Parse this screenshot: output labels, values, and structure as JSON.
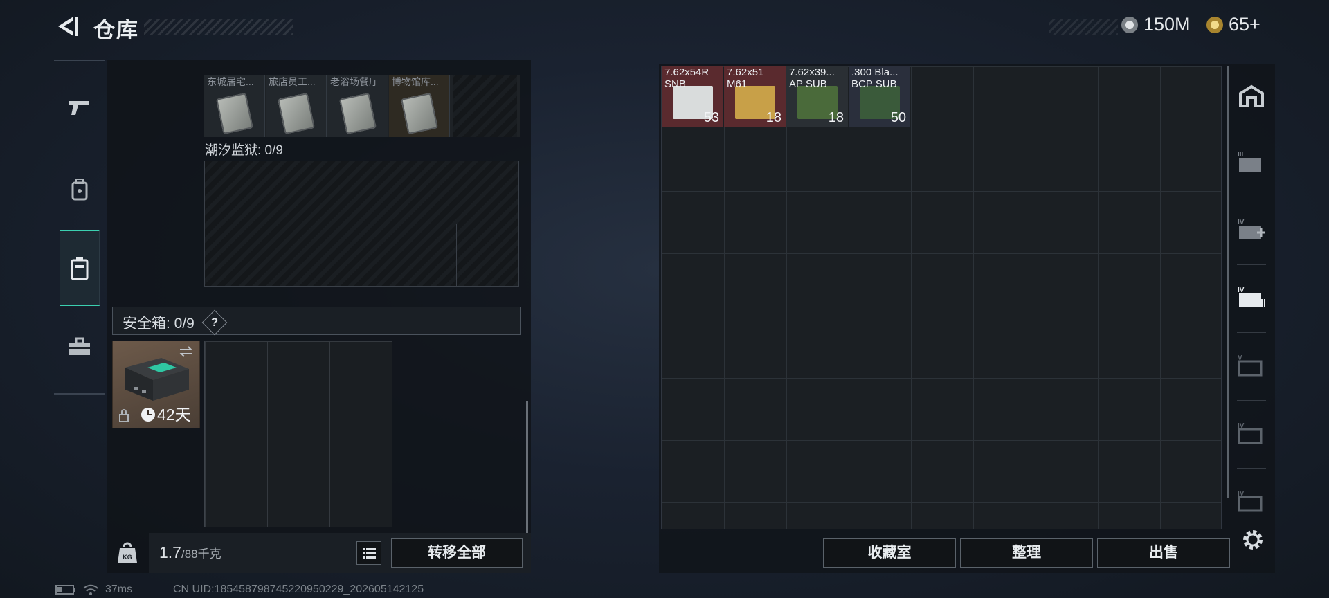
{
  "header": {
    "title": "仓库",
    "currency_silver": "150M",
    "currency_gold": "65+"
  },
  "side_tabs": [
    {
      "name": "weapons",
      "icon": "pistol-icon"
    },
    {
      "name": "gear",
      "icon": "backpack-icon"
    },
    {
      "name": "containers",
      "icon": "case-icon",
      "active": true
    },
    {
      "name": "supplies",
      "icon": "toolbox-icon"
    }
  ],
  "left_panel": {
    "keycards": [
      {
        "label": "东城居宅..."
      },
      {
        "label": "旅店员工..."
      },
      {
        "label": "老浴场餐厅"
      },
      {
        "label": "博物馆库..."
      }
    ],
    "section_label": "潮汐监狱: 0/9",
    "safebox_label": "安全箱:  0/9",
    "safebox_help": "?",
    "safebox_time": "42天",
    "weight_current": "1.7",
    "weight_max": "/88千克",
    "transfer_all": "转移全部"
  },
  "right_panel": {
    "items": [
      {
        "line1": "7.62x54R",
        "line2": "SNB",
        "count": "53",
        "bg": "#5a2a2e",
        "art": "#d9dcdc"
      },
      {
        "line1": "7.62x51",
        "line2": "M61",
        "count": "18",
        "bg": "#5a2a2e",
        "art": "#c8a048"
      },
      {
        "line1": "7.62x39...",
        "line2": "AP SUB",
        "count": "18",
        "bg": "#2a2f34",
        "art": "#4a6a3a"
      },
      {
        "line1": ".300 Bla...",
        "line2": "BCP SUB",
        "count": "50",
        "bg": "#2a2f3c",
        "art": "#3a5a3a"
      }
    ],
    "btn_collection": "收藏室",
    "btn_sort": "整理",
    "btn_sell": "出售"
  },
  "footer": {
    "ping": "37ms",
    "uid": "CN UID:185458798745220950229_202605142125"
  },
  "colors": {
    "accent": "#3bd0b0",
    "gold": "#c9a84a",
    "silver": "#9aa0a6"
  }
}
